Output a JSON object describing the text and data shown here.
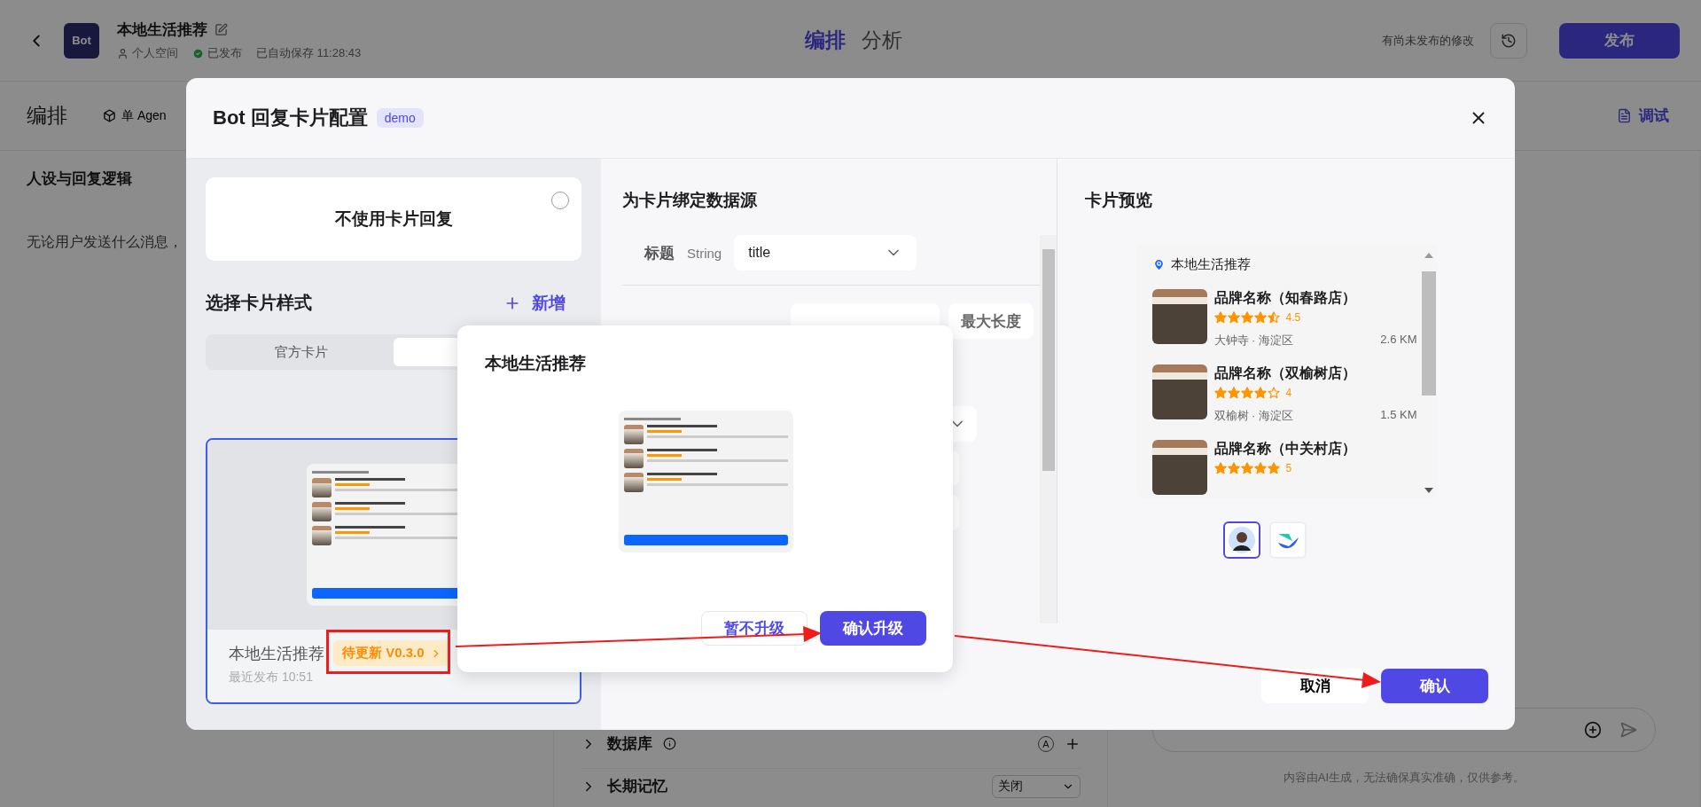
{
  "app_header": {
    "bot_avatar": "Bot",
    "title": "本地生活推荐",
    "workspace": "个人空间",
    "status": "已发布",
    "autosave": "已自动保存 11:28:43",
    "tabs": [
      {
        "label": "编排",
        "selected": true
      },
      {
        "label": "分析",
        "selected": false
      }
    ],
    "unpublished_note": "有尚未发布的修改",
    "publish_button": "发布"
  },
  "subheader": {
    "title": "编排",
    "mode": "单 Agen",
    "debug": "调试"
  },
  "persona": {
    "title": "人设与回复逻辑",
    "text": "无论用户发送什么消息，"
  },
  "skills": [
    {
      "label": "数据库",
      "badge": "A"
    },
    {
      "label": "长期记忆",
      "value": "关闭"
    }
  ],
  "chat": {
    "disclaimer": "内容由AI生成，无法确保真实准确，仅供参考。"
  },
  "modal": {
    "title": "Bot 回复卡片配置",
    "tag": "demo",
    "no_card_option": {
      "label": "不使用卡片回复",
      "selected": false
    },
    "style_section": {
      "title": "选择卡片样式",
      "add_button": "新增",
      "tabs": [
        {
          "label": "官方卡片",
          "selected": false
        },
        {
          "selected": true
        }
      ],
      "cards": [
        {
          "name": "本地生活推荐",
          "badge": "待更新 V0.3.0",
          "published": "最近发布 10:51",
          "selected": true
        }
      ]
    },
    "binding": {
      "title": "为卡片绑定数据源",
      "fields": [
        {
          "label": "标题",
          "type": "String",
          "value": "title"
        }
      ],
      "max_length_button": "最大长度",
      "hidden_fields": [
        {
          "kind": "input"
        },
        {
          "kind": "select"
        },
        {
          "kind": "checkbox"
        },
        {
          "kind": "checkbox"
        }
      ]
    },
    "preview": {
      "title": "卡片预览",
      "card_title": "本地生活推荐",
      "stores": [
        {
          "name": "品牌名称（知春路店）",
          "stars": 4.5,
          "rating": "4.5",
          "location": "大钟寺 · 海淀区",
          "distance": "2.6 KM"
        },
        {
          "name": "品牌名称（双榆树店）",
          "stars": 4,
          "rating": "4",
          "location": "双榆树 · 海淀区",
          "distance": "1.5 KM"
        },
        {
          "name": "品牌名称（中关村店）",
          "stars": 5,
          "rating": "5"
        }
      ],
      "channels": [
        {
          "kind": "avatar",
          "selected": true
        },
        {
          "kind": "logo",
          "selected": false
        }
      ]
    },
    "buttons": {
      "cancel": "取消",
      "confirm": "确认"
    }
  },
  "upgrade_popup": {
    "title": "本地生活推荐",
    "buttons": {
      "skip": "暂不升级",
      "confirm": "确认升级"
    }
  }
}
